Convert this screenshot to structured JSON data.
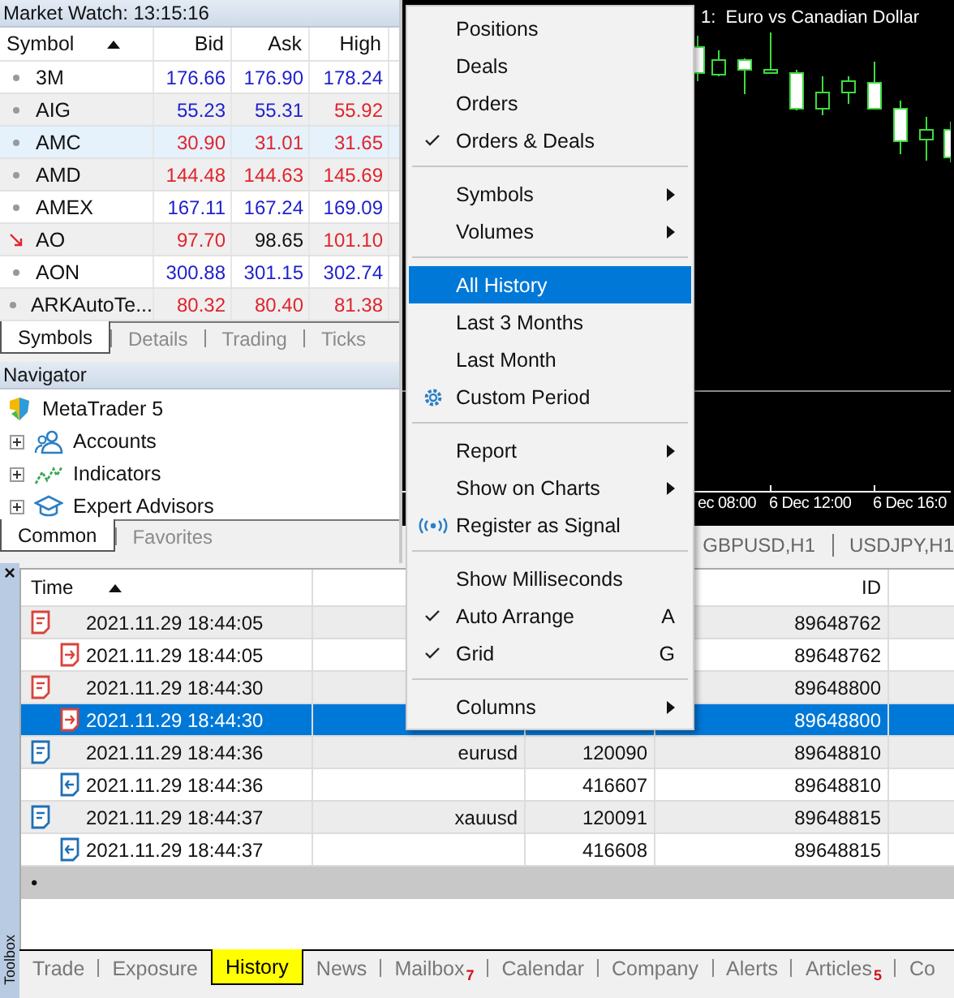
{
  "market_watch": {
    "title": "Market Watch: 13:15:16",
    "columns": [
      {
        "label": "Symbol",
        "sorted": true
      },
      {
        "label": "Bid",
        "sorted": false
      },
      {
        "label": "Ask",
        "sorted": false
      },
      {
        "label": "High",
        "sorted": false
      }
    ],
    "rows": [
      {
        "symbol": "3M",
        "kind": "steady",
        "selected": false,
        "quotes": [
          {
            "value": "176.66",
            "color": "#1f1fcc"
          },
          {
            "value": "176.90",
            "color": "#1f1fcc"
          },
          {
            "value": "178.24",
            "color": "#1f1fcc"
          }
        ]
      },
      {
        "symbol": "AIG",
        "kind": "steady",
        "selected": false,
        "quotes": [
          {
            "value": "55.23",
            "color": "#1f1fcc"
          },
          {
            "value": "55.31",
            "color": "#1f1fcc"
          },
          {
            "value": "55.92",
            "color": "#e0242c"
          }
        ]
      },
      {
        "symbol": "AMC",
        "kind": "steady",
        "selected": true,
        "quotes": [
          {
            "value": "30.90",
            "color": "#e0242c"
          },
          {
            "value": "31.01",
            "color": "#e0242c"
          },
          {
            "value": "31.65",
            "color": "#e0242c"
          }
        ]
      },
      {
        "symbol": "AMD",
        "kind": "steady",
        "selected": false,
        "quotes": [
          {
            "value": "144.48",
            "color": "#e0242c"
          },
          {
            "value": "144.63",
            "color": "#e0242c"
          },
          {
            "value": "145.69",
            "color": "#e0242c"
          }
        ]
      },
      {
        "symbol": "AMEX",
        "kind": "steady",
        "selected": false,
        "quotes": [
          {
            "value": "167.11",
            "color": "#1f1fcc"
          },
          {
            "value": "167.24",
            "color": "#1f1fcc"
          },
          {
            "value": "169.09",
            "color": "#1f1fcc"
          }
        ]
      },
      {
        "symbol": "AO",
        "kind": "falling",
        "selected": false,
        "quotes": [
          {
            "value": "97.70",
            "color": "#e0242c"
          },
          {
            "value": "98.65",
            "color": "#111111"
          },
          {
            "value": "101.10",
            "color": "#e0242c"
          }
        ]
      },
      {
        "symbol": "AON",
        "kind": "steady",
        "selected": false,
        "quotes": [
          {
            "value": "300.88",
            "color": "#1f1fcc"
          },
          {
            "value": "301.15",
            "color": "#1f1fcc"
          },
          {
            "value": "302.74",
            "color": "#1f1fcc"
          }
        ]
      },
      {
        "symbol": "ARKAutoTe...",
        "kind": "steady",
        "selected": false,
        "quotes": [
          {
            "value": "80.32",
            "color": "#e0242c"
          },
          {
            "value": "80.40",
            "color": "#e0242c"
          },
          {
            "value": "81.38",
            "color": "#e0242c"
          }
        ]
      }
    ],
    "tabs": [
      {
        "label": "Symbols",
        "selected": true
      },
      {
        "label": "Details",
        "selected": false
      },
      {
        "label": "Trading",
        "selected": false
      },
      {
        "label": "Ticks",
        "selected": false
      }
    ]
  },
  "navigator": {
    "title": "Navigator",
    "root": {
      "label": "MetaTrader 5",
      "children": [
        {
          "label": "Accounts",
          "expanded": false
        },
        {
          "label": "Indicators",
          "expanded": false
        },
        {
          "label": "Expert Advisors",
          "expanded": false
        }
      ]
    },
    "tabs": [
      {
        "label": "Common",
        "selected": true
      },
      {
        "label": "Favorites",
        "selected": false
      }
    ]
  },
  "chart": {
    "title": "1:  Euro vs Canadian Dollar",
    "time_labels": [
      "ec 08:00",
      "6 Dec 12:00",
      "6 Dec 16:0"
    ],
    "tabs": [
      {
        "label": "GBPUSD,H1",
        "selected": false
      },
      {
        "label": "USDJPY,H1",
        "selected": false
      }
    ]
  },
  "context_menu": {
    "items": [
      {
        "kind": "plain",
        "label": "Positions",
        "checked": false,
        "submenu": false,
        "selected": false
      },
      {
        "kind": "plain",
        "label": "Deals",
        "checked": false,
        "submenu": false,
        "selected": false
      },
      {
        "kind": "plain",
        "label": "Orders",
        "checked": false,
        "submenu": false,
        "selected": false
      },
      {
        "kind": "plain",
        "label": "Orders & Deals",
        "checked": true,
        "submenu": false,
        "selected": false
      },
      {
        "kind": "separator"
      },
      {
        "kind": "plain",
        "label": "Symbols",
        "checked": false,
        "submenu": true,
        "selected": false
      },
      {
        "kind": "plain",
        "label": "Volumes",
        "checked": false,
        "submenu": true,
        "selected": false
      },
      {
        "kind": "separator"
      },
      {
        "kind": "plain",
        "label": "All History",
        "checked": false,
        "submenu": false,
        "selected": true
      },
      {
        "kind": "plain",
        "label": "Last 3 Months",
        "checked": false,
        "submenu": false,
        "selected": false
      },
      {
        "kind": "plain",
        "label": "Last Month",
        "checked": false,
        "submenu": false,
        "selected": false
      },
      {
        "kind": "gear",
        "label": "Custom Period",
        "checked": false,
        "submenu": false,
        "selected": false
      },
      {
        "kind": "separator"
      },
      {
        "kind": "plain",
        "label": "Report",
        "checked": false,
        "submenu": true,
        "selected": false
      },
      {
        "kind": "plain",
        "label": "Show on Charts",
        "checked": false,
        "submenu": true,
        "selected": false
      },
      {
        "kind": "signal",
        "label": "Register as Signal",
        "checked": false,
        "submenu": false,
        "selected": false
      },
      {
        "kind": "separator"
      },
      {
        "kind": "plain",
        "label": "Show Milliseconds",
        "checked": false,
        "submenu": false,
        "selected": false
      },
      {
        "kind": "plain",
        "label": "Auto Arrange",
        "checked": true,
        "submenu": false,
        "selected": false,
        "shortcut": "A"
      },
      {
        "kind": "plain",
        "label": "Grid",
        "checked": true,
        "submenu": false,
        "selected": false,
        "shortcut": "G"
      },
      {
        "kind": "separator"
      },
      {
        "kind": "plain",
        "label": "Columns",
        "checked": false,
        "submenu": true,
        "selected": false
      }
    ]
  },
  "toolbox": {
    "title": "Toolbox",
    "close": "×",
    "time_header": "Time",
    "time_sorted": true,
    "id_header": "ID",
    "rows": [
      {
        "kind": "order",
        "color": "#d9433b",
        "time": "2021.11.29 18:44:05",
        "id": "89648762",
        "selected": false,
        "children": [
          {
            "kind": "deal",
            "color": "#d9433b",
            "time": "2021.11.29 18:44:05",
            "id": "89648762",
            "selected": false
          }
        ]
      },
      {
        "kind": "order",
        "color": "#d9433b",
        "time": "2021.11.29 18:44:30",
        "id": "89648800",
        "selected": false,
        "children": [
          {
            "kind": "deal",
            "color": "#d9433b",
            "time": "2021.11.29 18:44:30",
            "id": "89648800",
            "selected": true
          }
        ]
      },
      {
        "kind": "order",
        "color": "#1f6fb5",
        "time": "2021.11.29 18:44:36",
        "column_2": "eurusd",
        "column_3": "120090",
        "id": "89648810",
        "selected": false,
        "children": [
          {
            "kind": "deal",
            "color": "#1f6fb5",
            "time": "2021.11.29 18:44:36",
            "column_3": "416607",
            "id": "89648810",
            "selected": false
          }
        ]
      },
      {
        "kind": "order",
        "color": "#1f6fb5",
        "time": "2021.11.29 18:44:37",
        "column_2": "xauusd",
        "column_3": "120091",
        "id": "89648815",
        "selected": false,
        "children": [
          {
            "kind": "deal",
            "color": "#1f6fb5",
            "time": "2021.11.29 18:44:37",
            "column_3": "416608",
            "id": "89648815",
            "selected": false
          }
        ]
      }
    ],
    "footer_mark": "•",
    "tabs": [
      {
        "label": "Trade",
        "selected": false
      },
      {
        "label": "Exposure",
        "selected": false
      },
      {
        "label": "History",
        "selected": true
      },
      {
        "label": "News",
        "selected": false
      },
      {
        "label": "Mailbox",
        "badge": "7",
        "selected": false
      },
      {
        "label": "Calendar",
        "selected": false
      },
      {
        "label": "Company",
        "selected": false
      },
      {
        "label": "Alerts",
        "selected": false
      },
      {
        "label": "Articles",
        "badge": "5",
        "selected": false
      },
      {
        "label": "Co",
        "selected": false
      }
    ]
  }
}
